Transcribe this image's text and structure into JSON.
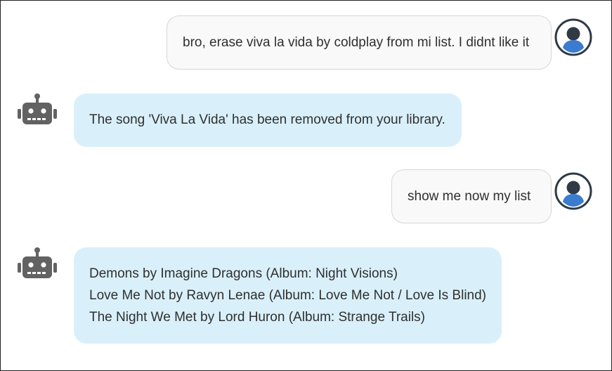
{
  "messages": [
    {
      "sender": "user",
      "text": "bro, erase viva la vida by coldplay from mi list. I didnt like it"
    },
    {
      "sender": "bot",
      "text": "The song 'Viva La Vida' has been removed from your library."
    },
    {
      "sender": "user",
      "text": "show me now my list"
    },
    {
      "sender": "bot",
      "lines": [
        "Demons by Imagine Dragons (Album: Night Visions)",
        "Love Me Not by Ravyn Lenae (Album: Love Me Not / Love Is Blind)",
        "The Night We Met by Lord Huron (Album: Strange Trails)"
      ]
    }
  ],
  "icons": {
    "user_avatar": "user-avatar-icon",
    "bot_avatar": "robot-icon"
  },
  "colors": {
    "user_bubble_bg": "#f9f9f9",
    "user_bubble_border": "#d7d7d7",
    "bot_bubble_bg": "#d9f0fa",
    "user_avatar_blue": "#3b7bd0",
    "user_avatar_dark": "#2f3a45",
    "robot_gray": "#626262"
  }
}
